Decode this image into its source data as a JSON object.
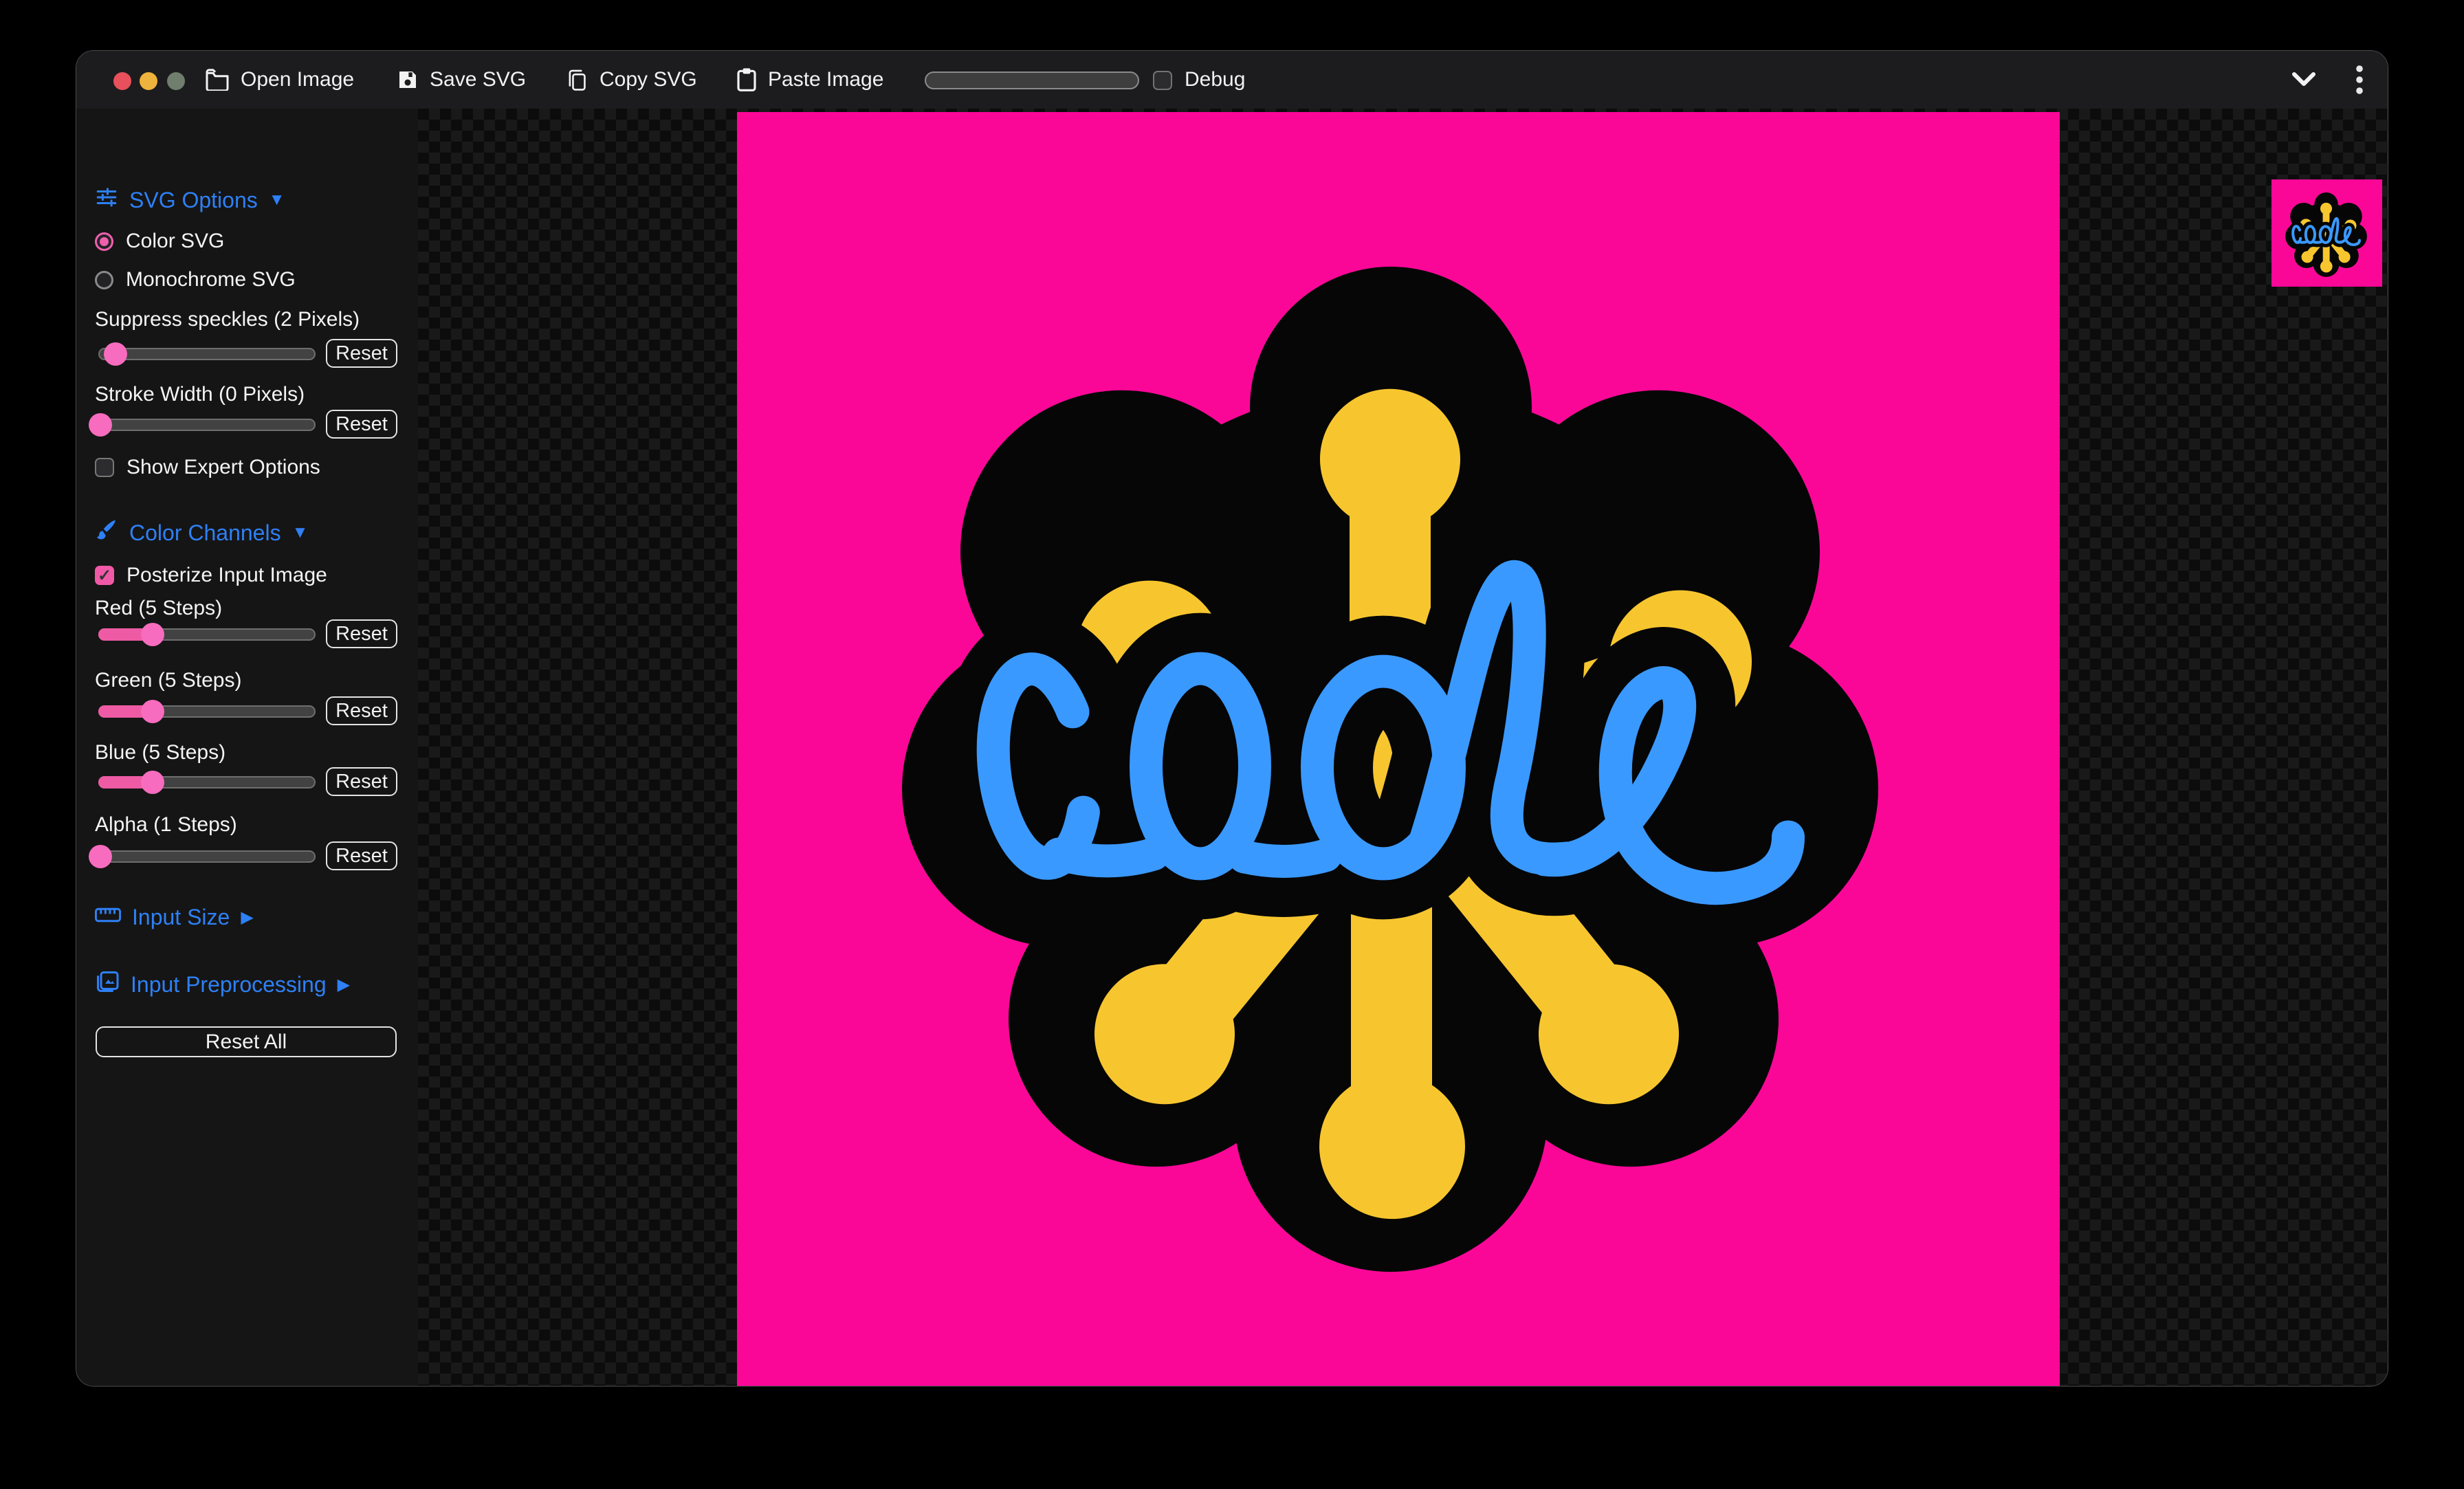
{
  "window": {
    "title": "",
    "toolbar": {
      "open_image": "Open Image",
      "save_svg": "Save SVG",
      "copy_svg": "Copy SVG",
      "paste_image": "Paste Image",
      "debug_label": "Debug",
      "debug_checked": false
    },
    "sidebar": {
      "svg_options": {
        "title": "SVG Options",
        "expanded_indicator": "▼",
        "color_svg": "Color SVG",
        "color_svg_selected": true,
        "monochrome_svg": "Monochrome SVG",
        "monochrome_svg_selected": false,
        "show_expert": "Show Expert Options",
        "show_expert_checked": false
      },
      "color_channels": {
        "title": "Color Channels",
        "expanded_indicator": "▼",
        "posterize": "Posterize Input Image",
        "posterize_checked": true
      },
      "input_size": {
        "title": "Input Size",
        "collapsed_indicator": "▶"
      },
      "input_preprocessing": {
        "title": "Input Preprocessing",
        "collapsed_indicator": "▶"
      },
      "reset_all": "Reset All",
      "sliders": {
        "speckles": {
          "label": "Suppress speckles (2 Pixels)",
          "reset": "Reset",
          "value_pct": 8,
          "filled": false
        },
        "stroke": {
          "label": "Stroke Width (0 Pixels)",
          "reset": "Reset",
          "value_pct": 1,
          "filled": false
        },
        "red": {
          "label": "Red (5 Steps)",
          "reset": "Reset",
          "value_pct": 25,
          "filled": true
        },
        "green": {
          "label": "Green (5 Steps)",
          "reset": "Reset",
          "value_pct": 25,
          "filled": true
        },
        "blue": {
          "label": "Blue (5 Steps)",
          "reset": "Reset",
          "value_pct": 25,
          "filled": true
        },
        "alpha": {
          "label": "Alpha (1 Steps)",
          "reset": "Reset",
          "value_pct": 1,
          "filled": false
        }
      }
    },
    "canvas": {
      "logo_text": "code",
      "logo_colors": {
        "pink": "#fb0798",
        "blue": "#3a99ff",
        "yellow": "#f7c62f",
        "black": "#060606"
      }
    },
    "accent_colors": {
      "header_blue": "#2e80f5",
      "control_pink": "#f76cbe"
    }
  }
}
